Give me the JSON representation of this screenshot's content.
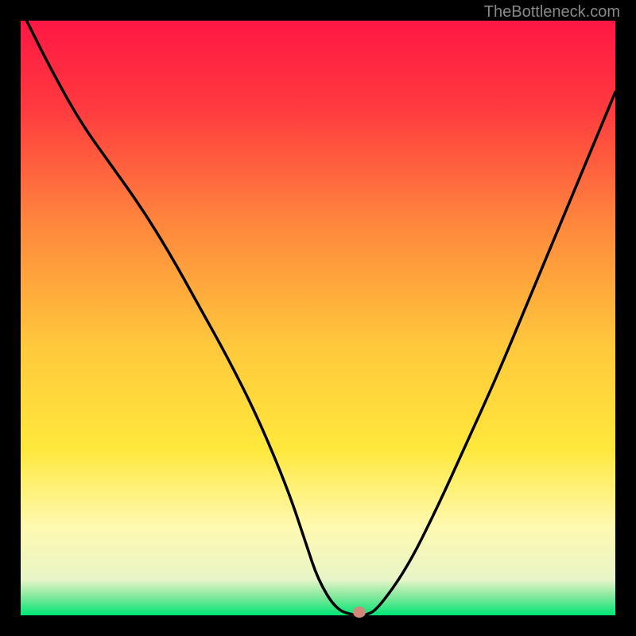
{
  "attribution": "TheBottleneck.com",
  "chart_data": {
    "type": "line",
    "title": "",
    "xlabel": "",
    "ylabel": "",
    "xlim": [
      0,
      100
    ],
    "ylim": [
      0,
      100
    ],
    "grid": false,
    "background_gradient": {
      "stops": [
        {
          "pos": 0,
          "color": "#ff1744"
        },
        {
          "pos": 15,
          "color": "#ff3b3f"
        },
        {
          "pos": 35,
          "color": "#ff8a3d"
        },
        {
          "pos": 55,
          "color": "#ffc93c"
        },
        {
          "pos": 72,
          "color": "#ffe83c"
        },
        {
          "pos": 85,
          "color": "#fff9b0"
        },
        {
          "pos": 94,
          "color": "#e8f5c8"
        },
        {
          "pos": 97,
          "color": "#7de89a"
        },
        {
          "pos": 100,
          "color": "#00e676"
        }
      ]
    },
    "series": [
      {
        "name": "bottleneck-curve",
        "color": "#000000",
        "x": [
          1,
          5,
          10,
          15,
          20,
          25,
          30,
          35,
          40,
          45,
          48,
          50,
          53,
          56,
          58,
          60,
          65,
          70,
          75,
          80,
          85,
          90,
          95,
          100
        ],
        "y": [
          100,
          92,
          83,
          76,
          69,
          61,
          52,
          43,
          33,
          21,
          12,
          6,
          1,
          0,
          0,
          1,
          8,
          18,
          29,
          40,
          52,
          64,
          76,
          88
        ]
      }
    ],
    "marker": {
      "x": 57,
      "y": 0.5,
      "color": "#d08878"
    }
  }
}
